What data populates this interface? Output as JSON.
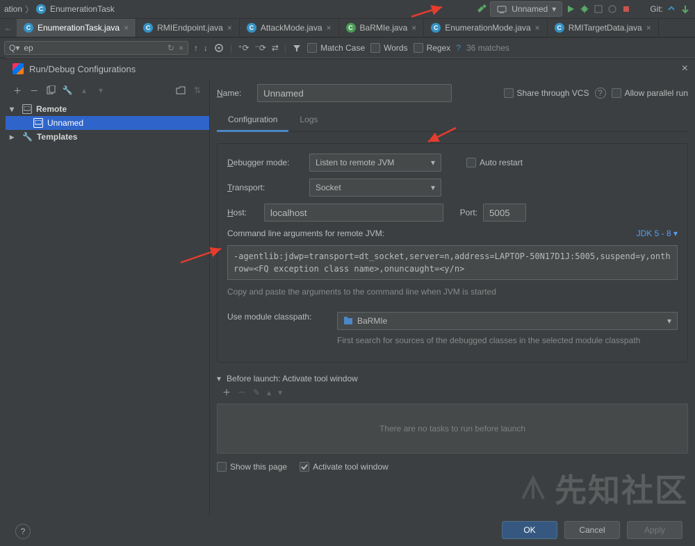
{
  "breadcrumb": {
    "seg1": "ation",
    "seg2": "EnumerationTask"
  },
  "runConfig": "Unnamed",
  "git_label": "Git:",
  "tabs": [
    {
      "label": "EnumerationTask.java",
      "active": true,
      "green": false
    },
    {
      "label": "RMIEndpoint.java",
      "active": false,
      "green": false
    },
    {
      "label": "AttackMode.java",
      "active": false,
      "green": false
    },
    {
      "label": "BaRMIe.java",
      "active": false,
      "green": true
    },
    {
      "label": "EnumerationMode.java",
      "active": false,
      "green": false
    },
    {
      "label": "RMITargetData.java",
      "active": false,
      "green": false
    }
  ],
  "search": {
    "query": "ep",
    "matches": "36 matches",
    "match_case": "Match Case",
    "words": "Words",
    "regex": "Regex"
  },
  "dialog": {
    "title": "Run/Debug Configurations",
    "tree": {
      "remote": "Remote",
      "unnamed": "Unnamed",
      "templates": "Templates"
    },
    "name_label": "Name:",
    "name_value": "Unnamed",
    "share_label": "Share through VCS",
    "parallel_label": "Allow parallel run",
    "subtabs": {
      "config": "Configuration",
      "logs": "Logs"
    },
    "debugger_mode_label": "Debugger mode:",
    "debugger_mode_value": "Listen to remote JVM",
    "auto_restart": "Auto restart",
    "transport_label": "Transport:",
    "transport_value": "Socket",
    "host_label": "Host:",
    "host_value": "localhost",
    "port_label": "Port:",
    "port_value": "5005",
    "cmd_label": "Command line arguments for remote JVM:",
    "jdk_link": "JDK 5 - 8",
    "cmd_value": "-agentlib:jdwp=transport=dt_socket,server=n,address=LAPTOP-50N17D1J:5005,suspend=y,onthrow=<FQ exception class name>,onuncaught=<y/n>",
    "cmd_hint": "Copy and paste the arguments to the command line when JVM is started",
    "module_label": "Use module classpath:",
    "module_value": "BaRMIe",
    "module_hint": "First search for sources of the debugged classes in the selected module classpath",
    "before_label": "Before launch: Activate tool window",
    "before_empty": "There are no tasks to run before launch",
    "show_page": "Show this page",
    "activate_tool": "Activate tool window",
    "ok": "OK",
    "cancel": "Cancel",
    "apply": "Apply"
  },
  "watermark": "先知社区"
}
